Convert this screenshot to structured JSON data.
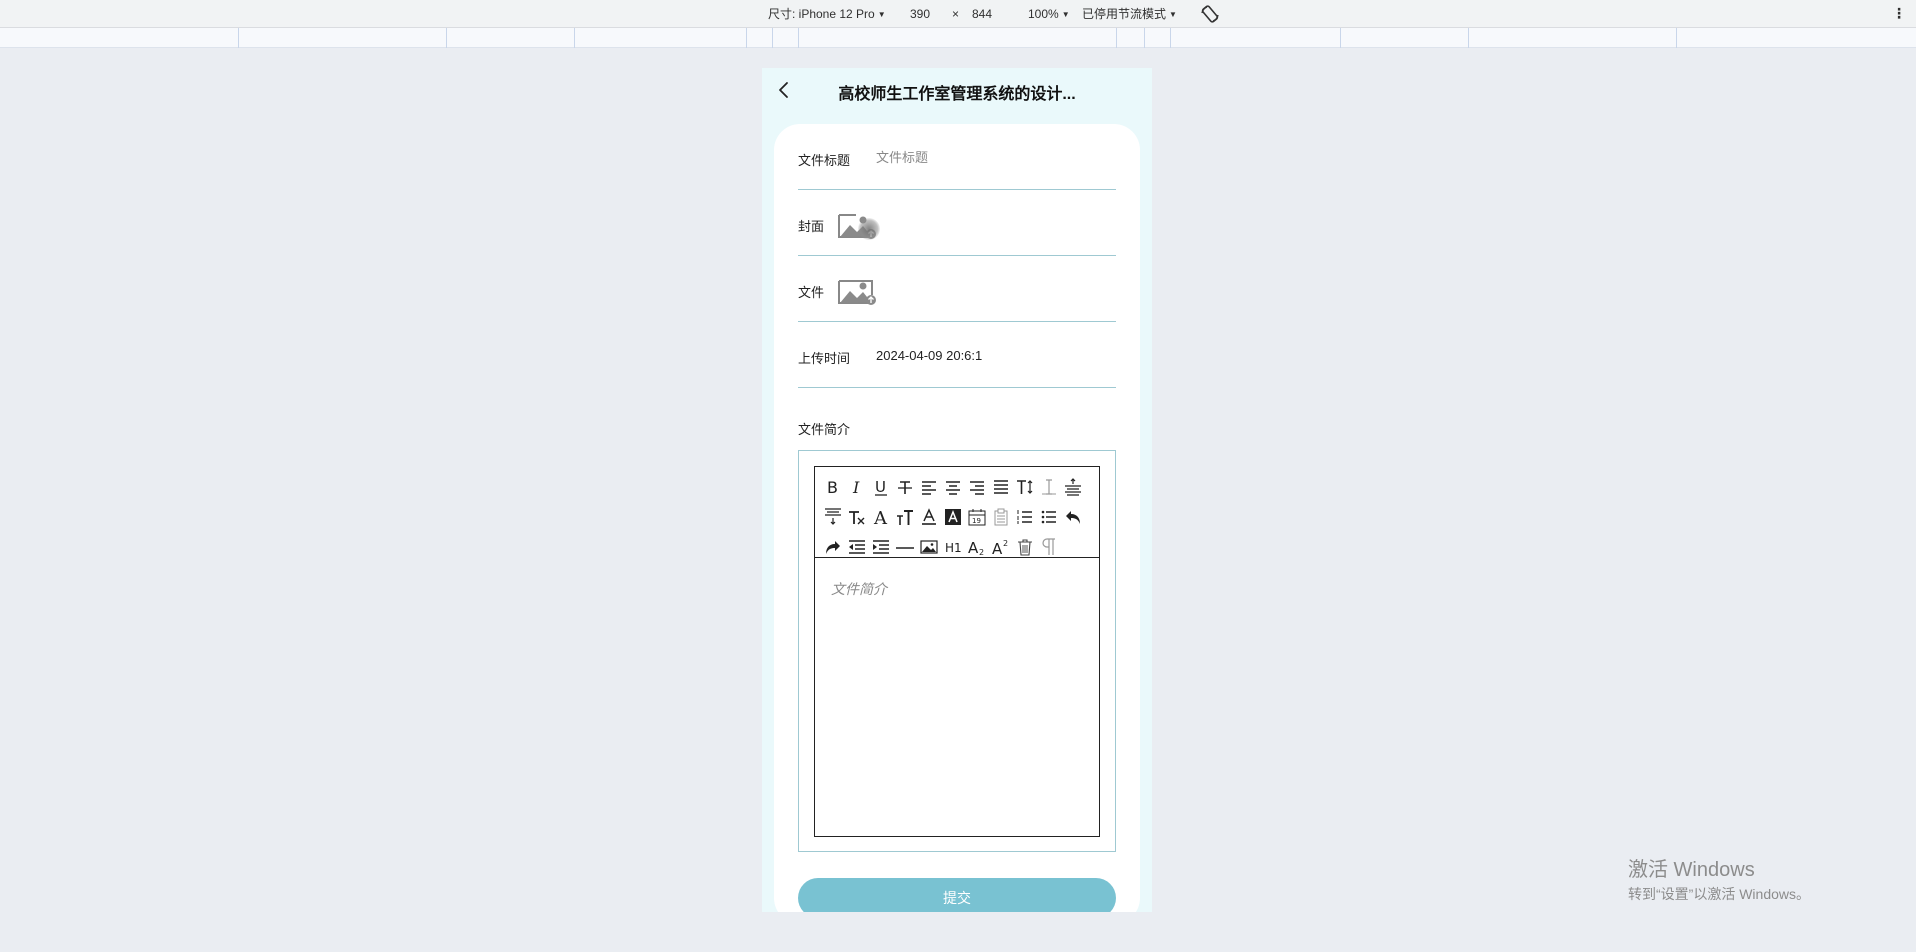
{
  "devtools": {
    "device_label": "尺寸: iPhone 12 Pro",
    "width": "390",
    "times": "×",
    "height": "844",
    "zoom": "100%",
    "throttle": "已停用节流模式",
    "icons": [
      "chevron-down-icon",
      "rotate-icon",
      "more-vert-icon"
    ]
  },
  "nav": {
    "title": "高校师生工作室管理系统的设计...",
    "back_icon": "chevron-left-icon"
  },
  "form": {
    "title_label": "文件标题",
    "title_placeholder": "文件标题",
    "cover_label": "封面",
    "file_label": "文件",
    "upload_icon": "image-upload-icon",
    "upload_time_label": "上传时间",
    "upload_time_value": "2024-04-09 20:6:1",
    "intro_label": "文件简介",
    "intro_placeholder": "文件简介",
    "submit_label": "提交"
  },
  "editor_tools": [
    "bold-icon",
    "italic-icon",
    "underline-icon",
    "strikethrough-icon",
    "align-left-icon",
    "align-center-icon",
    "align-right-icon",
    "align-justify-icon",
    "font-size-icon",
    "line-height-icon",
    "paragraph-spacing-top-icon",
    "paragraph-spacing-bottom-icon",
    "clear-format-icon",
    "font-family-icon",
    "text-size-icon",
    "font-color-icon",
    "background-color-icon",
    "date-icon",
    "paste-icon",
    "ordered-list-icon",
    "unordered-list-icon",
    "undo-icon",
    "redo-icon",
    "outdent-icon",
    "indent-icon",
    "horizontal-rule-icon",
    "insert-image-icon",
    "heading-icon",
    "subscript-icon",
    "superscript-icon",
    "delete-icon",
    "paragraph-icon"
  ],
  "colors": {
    "page_bg": "#eaedf2",
    "device_bg": "#eaf9fb",
    "accent": "#79c2d2",
    "divider": "#9fc9d2"
  },
  "watermark": {
    "line1": "激活 Windows",
    "line2": "转到“设置”以激活 Windows。"
  }
}
